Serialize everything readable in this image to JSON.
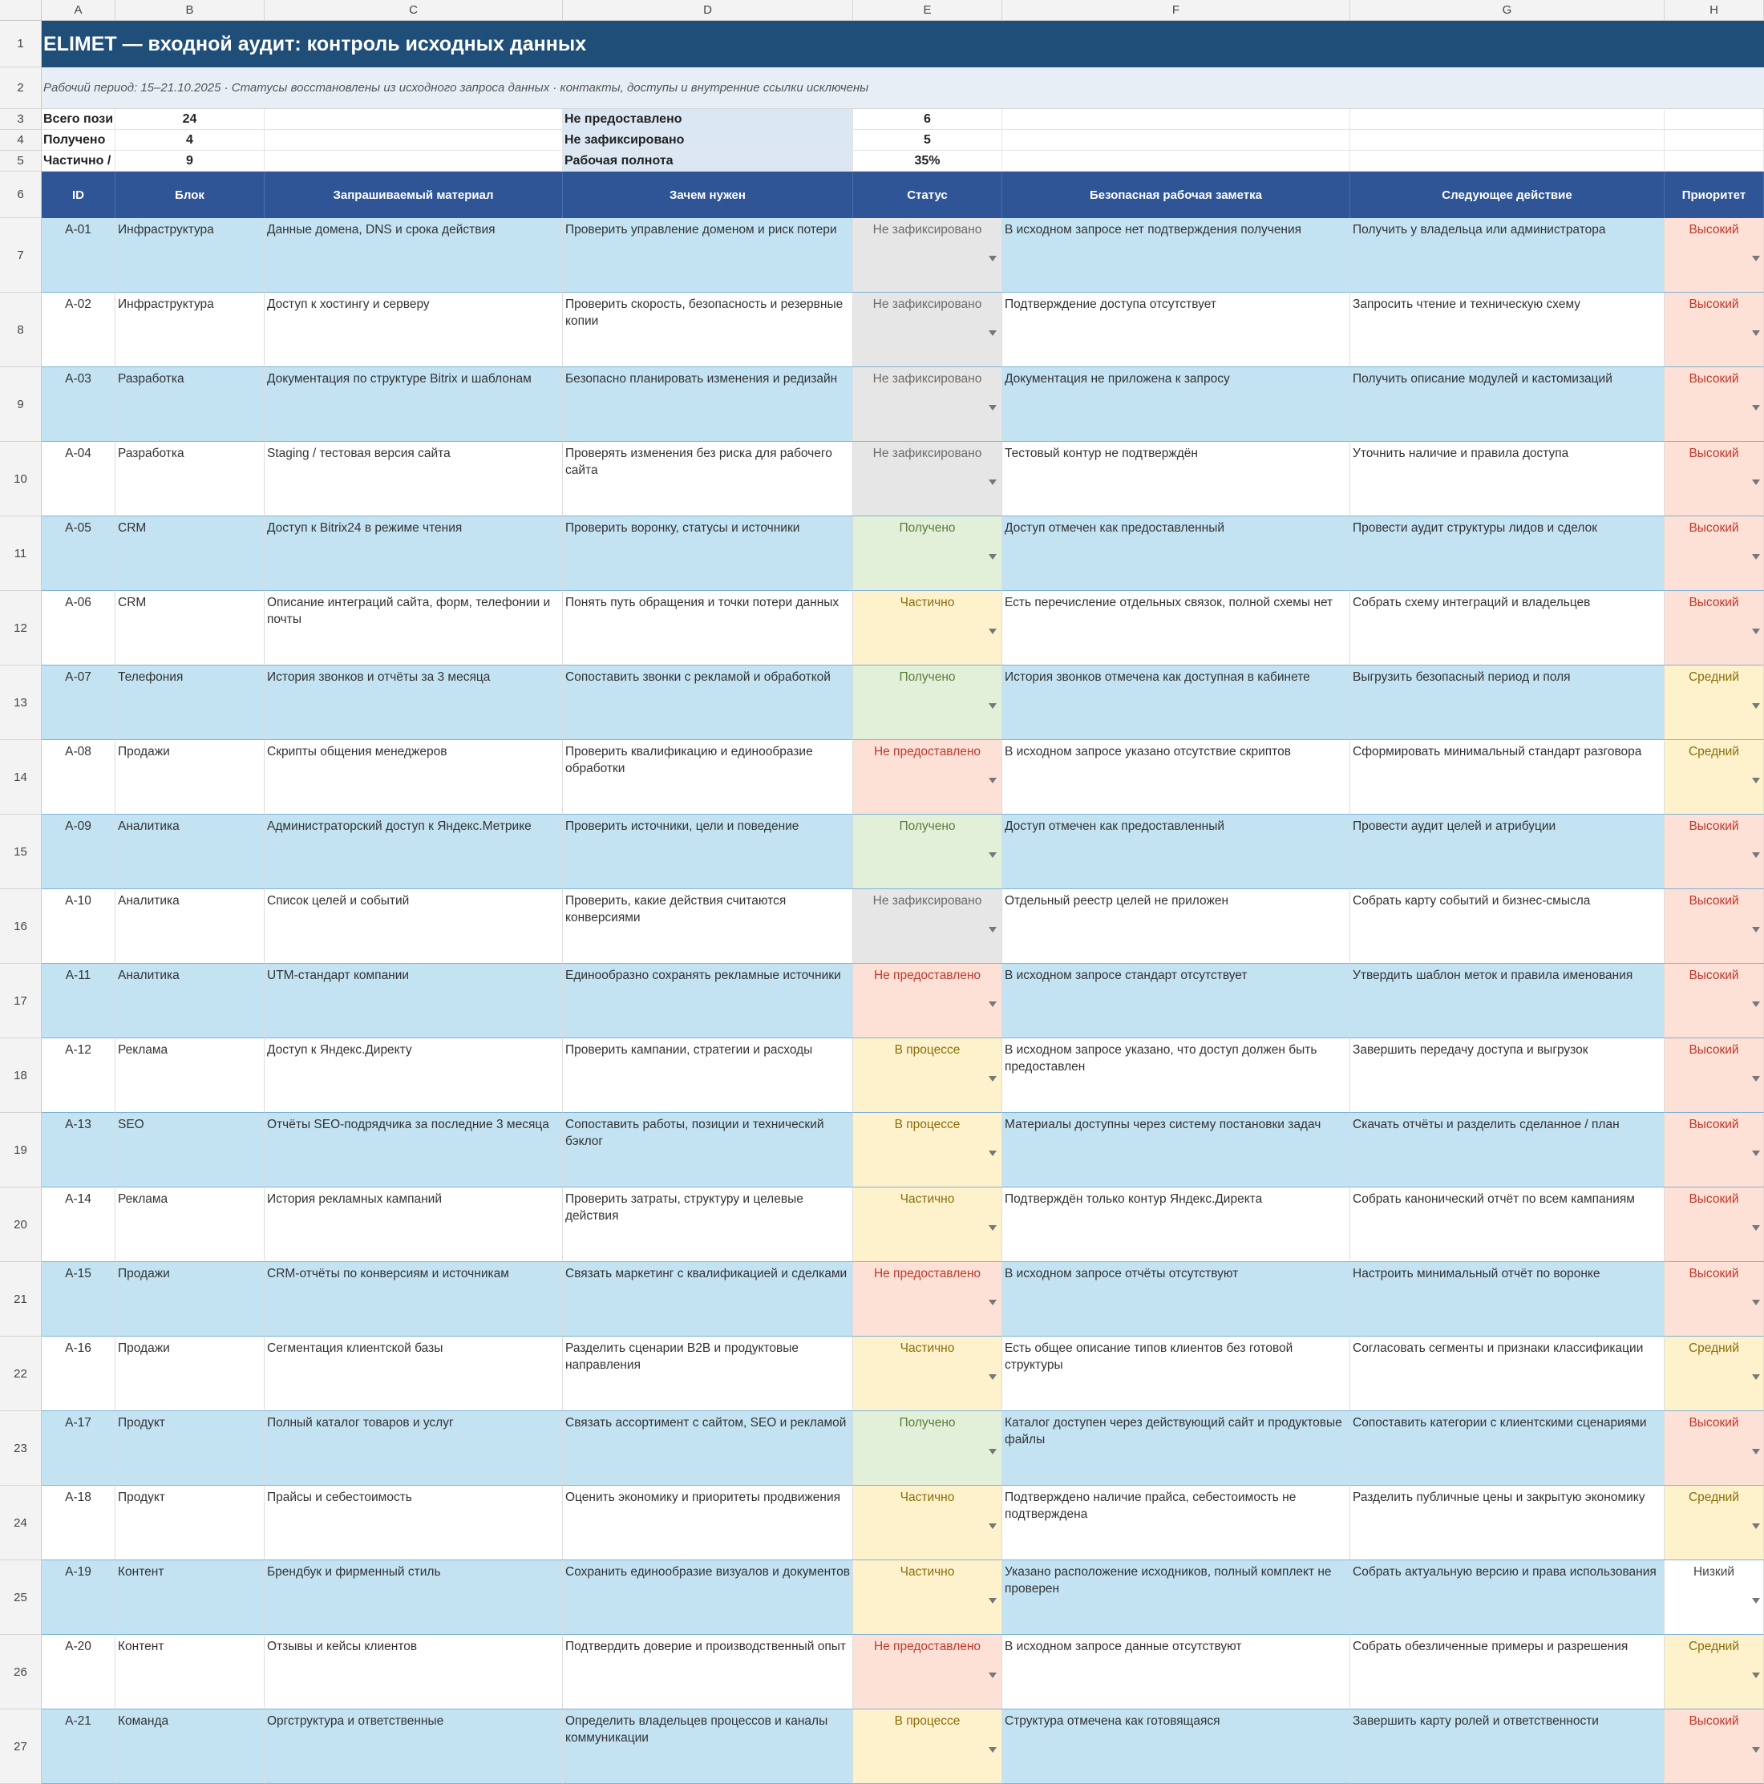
{
  "column_letters": [
    "A",
    "B",
    "C",
    "D",
    "E",
    "F",
    "G",
    "H"
  ],
  "title": "ELIMET — входной аудит: контроль исходных данных",
  "subtitle": "Рабочий период: 15–21.10.2025 · Статусы восстановлены из исходного запроса данных · контакты, доступы и внутренние ссылки исключены",
  "summary": {
    "total_label": "Всего пози",
    "total_value": "24",
    "received_label": "Получено",
    "received_value": "4",
    "partial_label": "Частично /",
    "partial_value": "9",
    "not_provided_label": "Не предоставлено",
    "not_provided_value": "6",
    "not_recorded_label": "Не зафиксировано",
    "not_recorded_value": "5",
    "completeness_label": "Рабочая полнота",
    "completeness_value": "35%"
  },
  "headers": [
    "ID",
    "Блок",
    "Запрашиваемый материал",
    "Зачем нужен",
    "Статус",
    "Безопасная рабочая заметка",
    "Следующее действие",
    "Приоритет"
  ],
  "rows": [
    {
      "row": "7",
      "id": "A-01",
      "block": "Инфраструктура",
      "material": "Данные домена, DNS и срока действия",
      "why": "Проверить управление доменом и риск потери",
      "status": "Не зафиксировано",
      "status_kind": "none",
      "note": "В исходном запросе нет подтверждения получения",
      "next": "Получить у владельца или администратора",
      "priority": "Высокий",
      "priority_kind": "high"
    },
    {
      "row": "8",
      "id": "A-02",
      "block": "Инфраструктура",
      "material": "Доступ к хостингу и серверу",
      "why": "Проверить скорость, безопасность и резервные копии",
      "status": "Не зафиксировано",
      "status_kind": "none",
      "note": "Подтверждение доступа отсутствует",
      "next": "Запросить чтение и техническую схему",
      "priority": "Высокий",
      "priority_kind": "high"
    },
    {
      "row": "9",
      "id": "A-03",
      "block": "Разработка",
      "material": "Документация по структуре Bitrix и шаблонам",
      "why": "Безопасно планировать изменения и редизайн",
      "status": "Не зафиксировано",
      "status_kind": "none",
      "note": "Документация не приложена к запросу",
      "next": "Получить описание модулей и кастомизаций",
      "priority": "Высокий",
      "priority_kind": "high"
    },
    {
      "row": "10",
      "id": "A-04",
      "block": "Разработка",
      "material": "Staging / тестовая версия сайта",
      "why": "Проверять изменения без риска для рабочего сайта",
      "status": "Не зафиксировано",
      "status_kind": "none",
      "note": "Тестовый контур не подтверждён",
      "next": "Уточнить наличие и правила доступа",
      "priority": "Высокий",
      "priority_kind": "high"
    },
    {
      "row": "11",
      "id": "A-05",
      "block": "CRM",
      "material": "Доступ к Bitrix24 в режиме чтения",
      "why": "Проверить воронку, статусы и источники",
      "status": "Получено",
      "status_kind": "got",
      "note": "Доступ отмечен как предоставленный",
      "next": "Провести аудит структуры лидов и сделок",
      "priority": "Высокий",
      "priority_kind": "high"
    },
    {
      "row": "12",
      "id": "A-06",
      "block": "CRM",
      "material": "Описание интеграций сайта, форм, телефонии и почты",
      "why": "Понять путь обращения и точки потери данных",
      "status": "Частично",
      "status_kind": "part",
      "note": "Есть перечисление отдельных связок, полной схемы нет",
      "next": "Собрать схему интеграций и владельцев",
      "priority": "Высокий",
      "priority_kind": "high"
    },
    {
      "row": "13",
      "id": "A-07",
      "block": "Телефония",
      "material": "История звонков и отчёты за 3 месяца",
      "why": "Сопоставить звонки с рекламой и обработкой",
      "status": "Получено",
      "status_kind": "got",
      "note": "История звонков отмечена как доступная в кабинете",
      "next": "Выгрузить безопасный период и поля",
      "priority": "Средний",
      "priority_kind": "mid"
    },
    {
      "row": "14",
      "id": "A-08",
      "block": "Продажи",
      "material": "Скрипты общения менеджеров",
      "why": "Проверить квалификацию и единообразие обработки",
      "status": "Не предоставлено",
      "status_kind": "no",
      "note": "В исходном запросе указано отсутствие скриптов",
      "next": "Сформировать минимальный стандарт разговора",
      "priority": "Средний",
      "priority_kind": "mid"
    },
    {
      "row": "15",
      "id": "A-09",
      "block": "Аналитика",
      "material": "Администраторский доступ к Яндекс.Метрике",
      "why": "Проверить источники, цели и поведение",
      "status": "Получено",
      "status_kind": "got",
      "note": "Доступ отмечен как предоставленный",
      "next": "Провести аудит целей и атрибуции",
      "priority": "Высокий",
      "priority_kind": "high"
    },
    {
      "row": "16",
      "id": "A-10",
      "block": "Аналитика",
      "material": "Список целей и событий",
      "why": "Проверить, какие действия считаются конверсиями",
      "status": "Не зафиксировано",
      "status_kind": "none",
      "note": "Отдельный реестр целей не приложен",
      "next": "Собрать карту событий и бизнес-смысла",
      "priority": "Высокий",
      "priority_kind": "high"
    },
    {
      "row": "17",
      "id": "A-11",
      "block": "Аналитика",
      "material": "UTM-стандарт компании",
      "why": "Единообразно сохранять рекламные источники",
      "status": "Не предоставлено",
      "status_kind": "no",
      "note": "В исходном запросе стандарт отсутствует",
      "next": "Утвердить шаблон меток и правила именования",
      "priority": "Высокий",
      "priority_kind": "high"
    },
    {
      "row": "18",
      "id": "A-12",
      "block": "Реклама",
      "material": "Доступ к Яндекс.Директу",
      "why": "Проверить кампании, стратегии и расходы",
      "status": "В процессе",
      "status_kind": "prog",
      "note": "В исходном запросе указано, что доступ должен быть предоставлен",
      "next": "Завершить передачу доступа и выгрузок",
      "priority": "Высокий",
      "priority_kind": "high"
    },
    {
      "row": "19",
      "id": "A-13",
      "block": "SEO",
      "material": "Отчёты SEO-подрядчика за последние 3 месяца",
      "why": "Сопоставить работы, позиции и технический бэклог",
      "status": "В процессе",
      "status_kind": "prog",
      "note": "Материалы доступны через систему постановки задач",
      "next": "Скачать отчёты и разделить сделанное / план",
      "priority": "Высокий",
      "priority_kind": "high"
    },
    {
      "row": "20",
      "id": "A-14",
      "block": "Реклама",
      "material": "История рекламных кампаний",
      "why": "Проверить затраты, структуру и целевые действия",
      "status": "Частично",
      "status_kind": "part",
      "note": "Подтверждён только контур Яндекс.Директа",
      "next": "Собрать канонический отчёт по всем кампаниям",
      "priority": "Высокий",
      "priority_kind": "high"
    },
    {
      "row": "21",
      "id": "A-15",
      "block": "Продажи",
      "material": "CRM-отчёты по конверсиям и источникам",
      "why": "Связать маркетинг с квалификацией и сделками",
      "status": "Не предоставлено",
      "status_kind": "no",
      "note": "В исходном запросе отчёты отсутствуют",
      "next": "Настроить минимальный отчёт по воронке",
      "priority": "Высокий",
      "priority_kind": "high"
    },
    {
      "row": "22",
      "id": "A-16",
      "block": "Продажи",
      "material": "Сегментация клиентской базы",
      "why": "Разделить сценарии B2B и продуктовые направления",
      "status": "Частично",
      "status_kind": "part",
      "note": "Есть общее описание типов клиентов без готовой структуры",
      "next": "Согласовать сегменты и признаки классификации",
      "priority": "Средний",
      "priority_kind": "mid"
    },
    {
      "row": "23",
      "id": "A-17",
      "block": "Продукт",
      "material": "Полный каталог товаров и услуг",
      "why": "Связать ассортимент с сайтом, SEO и рекламой",
      "status": "Получено",
      "status_kind": "got",
      "note": "Каталог доступен через действующий сайт и продуктовые файлы",
      "next": "Сопоставить категории с клиентскими сценариями",
      "priority": "Высокий",
      "priority_kind": "high"
    },
    {
      "row": "24",
      "id": "A-18",
      "block": "Продукт",
      "material": "Прайсы и себестоимость",
      "why": "Оценить экономику и приоритеты продвижения",
      "status": "Частично",
      "status_kind": "part",
      "note": "Подтверждено наличие прайса, себестоимость не подтверждена",
      "next": "Разделить публичные цены и закрытую экономику",
      "priority": "Средний",
      "priority_kind": "mid"
    },
    {
      "row": "25",
      "id": "A-19",
      "block": "Контент",
      "material": "Брендбук и фирменный стиль",
      "why": "Сохранить единообразие визуалов и документов",
      "status": "Частично",
      "status_kind": "part",
      "note": "Указано расположение исходников, полный комплект не проверен",
      "next": "Собрать актуальную версию и права использования",
      "priority": "Низкий",
      "priority_kind": "low"
    },
    {
      "row": "26",
      "id": "A-20",
      "block": "Контент",
      "material": "Отзывы и кейсы клиентов",
      "why": "Подтвердить доверие и производственный опыт",
      "status": "Не предоставлено",
      "status_kind": "no",
      "note": "В исходном запросе данные отсутствуют",
      "next": "Собрать обезличенные примеры и разрешения",
      "priority": "Средний",
      "priority_kind": "mid"
    },
    {
      "row": "27",
      "id": "A-21",
      "block": "Команда",
      "material": "Оргструктура и ответственные",
      "why": "Определить владельцев процессов и каналы коммуникации",
      "status": "В процессе",
      "status_kind": "prog",
      "note": "Структура отмечена как готовящаяся",
      "next": "Завершить карту ролей и ответственности",
      "priority": "Высокий",
      "priority_kind": "high"
    }
  ]
}
